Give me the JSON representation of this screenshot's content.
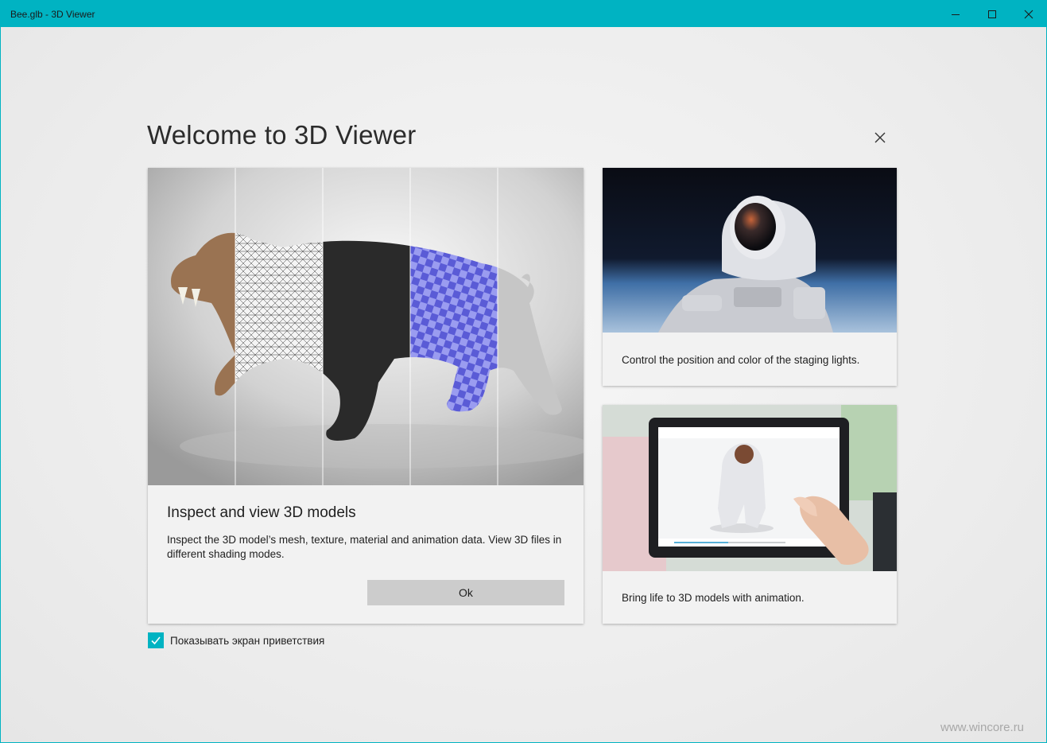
{
  "window": {
    "title": "Bee.glb - 3D Viewer",
    "accent": "#00b3c2"
  },
  "dialog": {
    "heading": "Welcome to 3D Viewer",
    "close_icon": "close-icon"
  },
  "main_card": {
    "title": "Inspect and view 3D models",
    "description": "Inspect the 3D model’s mesh, texture, material and animation data. View 3D files in different shading modes.",
    "ok_label": "Ok"
  },
  "lights_card": {
    "description": "Control the position and color of the staging lights."
  },
  "animation_card": {
    "description": "Bring life to 3D models with animation."
  },
  "welcome_toggle": {
    "label": "Показывать экран приветствия",
    "checked": true
  },
  "watermark": "www.wincore.ru"
}
